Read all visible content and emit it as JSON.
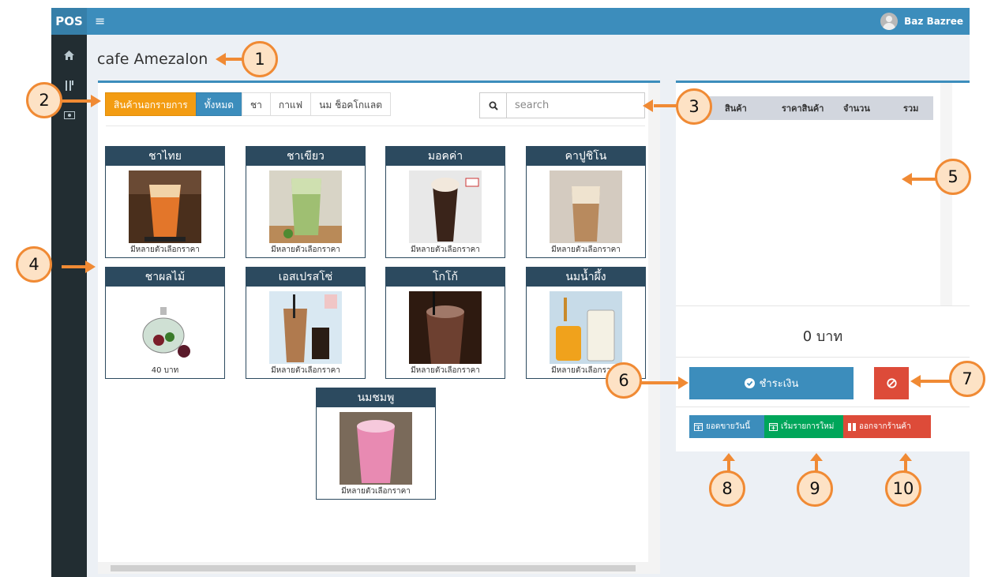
{
  "topbar": {
    "brand": "POS",
    "menu_icon": "hamburger-icon",
    "user_name": "Baz Bazree"
  },
  "sidebar": {
    "icons": [
      "home-icon",
      "utensils-icon",
      "money-icon"
    ]
  },
  "page": {
    "title": "cafe Amezalon"
  },
  "tabs": [
    {
      "label": "สินค้านอกรายการ",
      "style": "orange"
    },
    {
      "label": "ทั้งหมด",
      "style": "blue"
    },
    {
      "label": "ชา",
      "style": "default"
    },
    {
      "label": "กาแฟ",
      "style": "default"
    },
    {
      "label": "นม ช็อคโกแลต",
      "style": "default"
    }
  ],
  "search": {
    "placeholder": "search",
    "icon": "search-icon"
  },
  "products": [
    {
      "name": "ชาไทย",
      "price": "มีหลายตัวเลือกราคา"
    },
    {
      "name": "ชาเขียว",
      "price": "มีหลายตัวเลือกราคา"
    },
    {
      "name": "มอคค่า",
      "price": "มีหลายตัวเลือกราคา"
    },
    {
      "name": "คาปูชิโน",
      "price": "มีหลายตัวเลือกราคา"
    },
    {
      "name": "ชาผลไม้",
      "price": "40 บาท"
    },
    {
      "name": "เอสเปรสโซ่",
      "price": "มีหลายตัวเลือกราคา"
    },
    {
      "name": "โกโก้",
      "price": "มีหลายตัวเลือกราคา"
    },
    {
      "name": "นมน้ำผึ้ง",
      "price": "มีหลายตัวเลือกราคา"
    },
    {
      "name": "นมชมพู",
      "price": "มีหลายตัวเลือกราคา"
    }
  ],
  "order": {
    "columns": [
      "สินค้า",
      "ราคาสินค้า",
      "จำนวน",
      "รวม"
    ],
    "total": "0 บาท",
    "pay_label": "ชำระเงิน",
    "cancel_icon": "ban-icon"
  },
  "actions": {
    "today_sales": "ยอดขายวันนี้",
    "new_order": "เริ่มรายการใหม่",
    "exit_shop": "ออกจากร้านค้า"
  },
  "callouts": [
    "1",
    "2",
    "3",
    "4",
    "5",
    "6",
    "7",
    "8",
    "9",
    "10"
  ],
  "colors": {
    "topbar": "#3c8dbc",
    "sidebar": "#222d32",
    "card_header": "#2c4a5f",
    "orange_tab": "#f39c12",
    "pay": "#3c8dbc",
    "cancel": "#dd4b39",
    "new_order": "#00a65a",
    "callout_stroke": "#f08a34"
  }
}
